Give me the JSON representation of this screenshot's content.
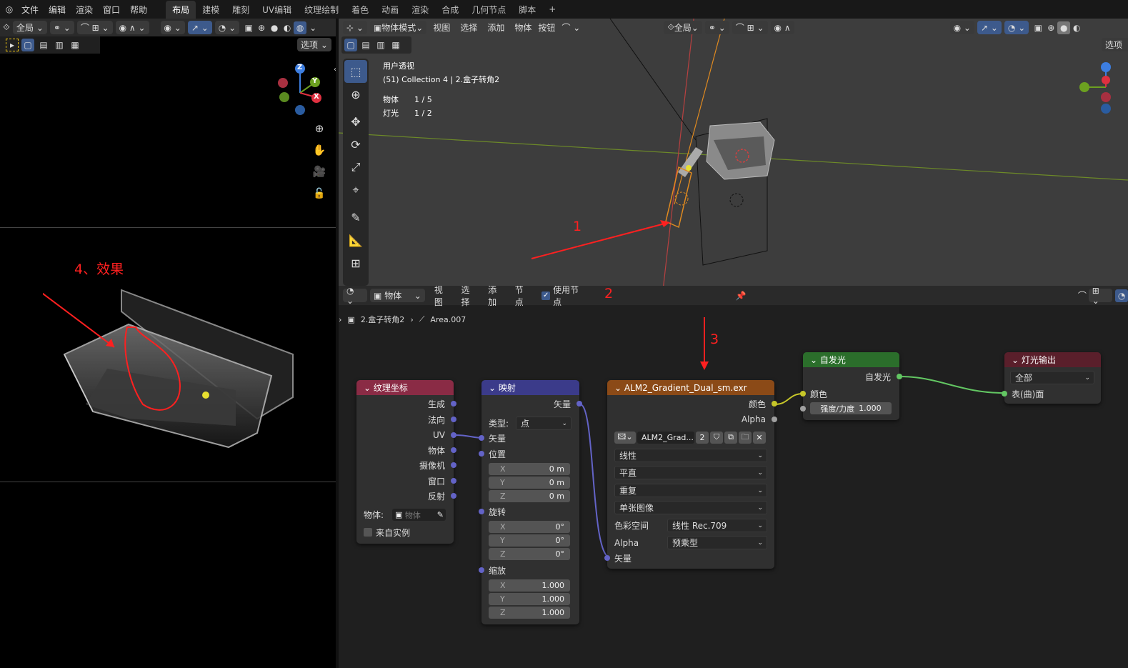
{
  "topbar": {
    "menus": [
      "文件",
      "编辑",
      "渲染",
      "窗口",
      "帮助"
    ],
    "tabs": [
      "布局",
      "建模",
      "雕刻",
      "UV编辑",
      "纹理绘制",
      "着色",
      "动画",
      "渲染",
      "合成",
      "几何节点",
      "脚本",
      "+"
    ],
    "active_tab": "布局"
  },
  "left_header": {
    "global": "全局",
    "options": "选项"
  },
  "viewport3d": {
    "menu": [
      "物体模式",
      "视图",
      "选择",
      "添加",
      "物体",
      "按钮"
    ],
    "global": "全局",
    "options": "选项",
    "overlay_title": "用户透视",
    "collection_line": "(51) Collection 4 | 2.盒子转角2",
    "stats": [
      {
        "label": "物体",
        "value": "1 / 5"
      },
      {
        "label": "灯光",
        "value": "1 / 2"
      }
    ]
  },
  "gizmo_axes": {
    "z": "Z",
    "y": "Y",
    "x": "X"
  },
  "node_editor": {
    "header_type": "物体",
    "menu": [
      "视图",
      "选择",
      "添加",
      "节点"
    ],
    "use_nodes_label": "使用节点",
    "use_nodes": true,
    "breadcrumb": {
      "object": "2.盒子转角2",
      "light": "Area.007"
    }
  },
  "annotations": {
    "a1": "1",
    "a2": "2",
    "a3": "3",
    "a4": "4、效果"
  },
  "nodes": {
    "texcoord": {
      "title": "纹理坐标",
      "outputs": [
        "生成",
        "法向",
        "UV",
        "物体",
        "摄像机",
        "窗口",
        "反射"
      ],
      "object_label": "物体:",
      "object_placeholder": "物体",
      "from_instancer": "来自实例"
    },
    "mapping": {
      "title": "映射",
      "output": "矢量",
      "type_label": "类型:",
      "type_value": "点",
      "vector_in": "矢量",
      "location": "位置",
      "loc": [
        {
          "axis": "X",
          "value": "0 m"
        },
        {
          "axis": "Y",
          "value": "0 m"
        },
        {
          "axis": "Z",
          "value": "0 m"
        }
      ],
      "rotation": "旋转",
      "rot": [
        {
          "axis": "X",
          "value": "0°"
        },
        {
          "axis": "Y",
          "value": "0°"
        },
        {
          "axis": "Z",
          "value": "0°"
        }
      ],
      "scale": "缩放",
      "scl": [
        {
          "axis": "X",
          "value": "1.000"
        },
        {
          "axis": "Y",
          "value": "1.000"
        },
        {
          "axis": "Z",
          "value": "1.000"
        }
      ]
    },
    "image": {
      "title": "ALM2_Gradient_Dual_sm.exr",
      "out_color": "颜色",
      "out_alpha": "Alpha",
      "image_name": "ALM2_Grad...",
      "users": "2",
      "interp": "线性",
      "projection": "平直",
      "extension": "重复",
      "source": "单张图像",
      "colorspace_label": "色彩空间",
      "colorspace": "线性 Rec.709",
      "alpha_label": "Alpha",
      "alpha_mode": "预乘型",
      "vector_in": "矢量"
    },
    "emission": {
      "title": "自发光",
      "out": "自发光",
      "color": "颜色",
      "strength_label": "强度/力度",
      "strength": "1.000"
    },
    "output": {
      "title": "灯光输出",
      "target": "全部",
      "surface": "表(曲)面"
    }
  },
  "colors": {
    "texcoord": "#8a2b45",
    "mapping": "#3b3b8a",
    "image": "#8b4a17",
    "emission": "#2b6e2b",
    "output": "#5a1f2b",
    "annotation": "#ff2020"
  }
}
